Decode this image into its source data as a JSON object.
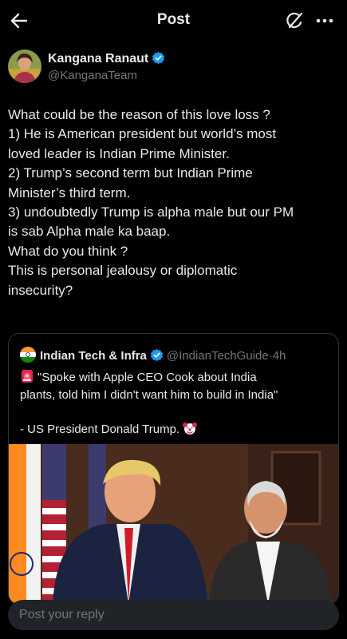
{
  "header": {
    "title": "Post"
  },
  "author": {
    "name": "Kangana Ranaut",
    "handle": "@KanganaTeam"
  },
  "tweet": {
    "lines": [
      "What could be the reason of this love loss ?",
      "1) He is American president but world’s most",
      "loved leader is Indian Prime Minister.",
      "2) Trump’s second term but Indian Prime",
      "Minister’s third term.",
      "3) undoubtedly Trump is alpha male but our PM",
      "is sab Alpha male ka baap.",
      "What do you think ?",
      "This is personal jealousy or diplomatic",
      "insecurity?"
    ]
  },
  "quote": {
    "name": "Indian Tech & Infra",
    "handle": "@IndianTechGuide",
    "separator": "·",
    "time": "4h",
    "lines": [
      "\"Spoke with Apple CEO Cook about India",
      "plants, told him I didn't want him to build in India\"",
      "",
      "- US President Donald Trump."
    ],
    "icons": [
      "siren-emoji",
      "clown-emoji"
    ]
  },
  "reply": {
    "placeholder": "Post your reply"
  },
  "colors": {
    "background": "#000000",
    "text": "#e7e9ea",
    "muted": "#71767b",
    "verified": "#1d9bf0",
    "border": "#2f3336"
  },
  "icons": [
    "back-arrow-icon",
    "grok-icon",
    "more-icon",
    "verified-icon"
  ]
}
